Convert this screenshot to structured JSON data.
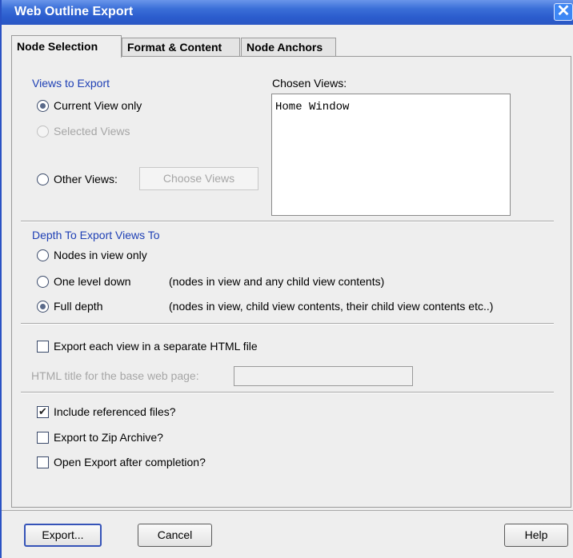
{
  "window": {
    "title": "Web Outline Export",
    "close_glyph": "✕"
  },
  "tabs": [
    {
      "label": "Node Selection",
      "active": true
    },
    {
      "label": "Format & Content",
      "active": false
    },
    {
      "label": "Node Anchors",
      "active": false
    }
  ],
  "views": {
    "section_label": "Views to Export",
    "options": [
      {
        "label": "Current View only",
        "selected": true,
        "enabled": true
      },
      {
        "label": "Selected Views",
        "selected": false,
        "enabled": false
      },
      {
        "label": "Other Views:",
        "selected": false,
        "enabled": true
      }
    ],
    "choose_button": "Choose Views",
    "chosen_label": "Chosen Views:",
    "chosen_items": [
      "Home Window"
    ]
  },
  "depth": {
    "section_label": "Depth To Export Views To",
    "options": [
      {
        "label": "Nodes in view only",
        "desc": "",
        "selected": false
      },
      {
        "label": "One level down",
        "desc": "(nodes in view and any child view contents)",
        "selected": false
      },
      {
        "label": "Full depth",
        "desc": "(nodes in view, child view contents, their child view contents etc..)",
        "selected": true
      }
    ]
  },
  "separate_html": {
    "label": "Export each view in a separate HTML file",
    "checked": false
  },
  "html_title": {
    "label": "HTML title for the base web page:",
    "value": "",
    "enabled": false
  },
  "options": [
    {
      "label": "Include referenced files?",
      "checked": true
    },
    {
      "label": "Export to Zip Archive?",
      "checked": false
    },
    {
      "label": "Open Export after completion?",
      "checked": false
    }
  ],
  "buttons": {
    "export": "Export...",
    "cancel": "Cancel",
    "help": "Help"
  },
  "colors": {
    "title_bar": "#2b5ccd",
    "section_label": "#1f40b5",
    "disabled_text": "#a6a6a6"
  }
}
